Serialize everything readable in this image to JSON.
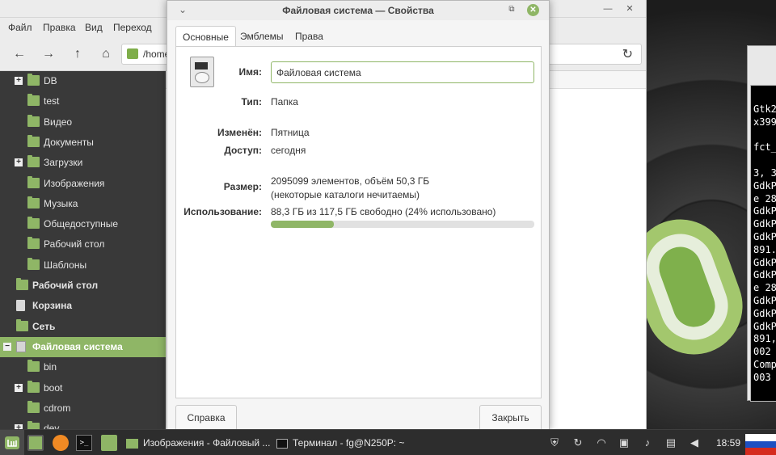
{
  "file_manager": {
    "menu": [
      "Файл",
      "Правка",
      "Вид",
      "Переход"
    ],
    "location": "/home",
    "sidebar": [
      {
        "label": "DB",
        "expander": "+",
        "kind": "folder",
        "bold": false
      },
      {
        "label": "test",
        "expander": "",
        "kind": "folder",
        "bold": false
      },
      {
        "label": "Видео",
        "expander": "",
        "kind": "folder",
        "bold": false
      },
      {
        "label": "Документы",
        "expander": "",
        "kind": "folder",
        "bold": false
      },
      {
        "label": "Загрузки",
        "expander": "+",
        "kind": "folder",
        "bold": false
      },
      {
        "label": "Изображения",
        "expander": "",
        "kind": "folder",
        "bold": false
      },
      {
        "label": "Музыка",
        "expander": "",
        "kind": "folder",
        "bold": false
      },
      {
        "label": "Общедоступные",
        "expander": "",
        "kind": "folder",
        "bold": false
      },
      {
        "label": "Рабочий стол",
        "expander": "",
        "kind": "folder",
        "bold": false
      },
      {
        "label": "Шаблоны",
        "expander": "",
        "kind": "folder",
        "bold": false
      },
      {
        "label": "Рабочий стол",
        "expander": "",
        "kind": "folder",
        "bold": true
      },
      {
        "label": "Корзина",
        "expander": "",
        "kind": "trash",
        "bold": true
      },
      {
        "label": "Сеть",
        "expander": "",
        "kind": "folder",
        "bold": true
      },
      {
        "label": "Файловая система",
        "expander": "−",
        "kind": "drive",
        "bold": true,
        "active": true
      },
      {
        "label": "bin",
        "expander": "",
        "kind": "folder",
        "bold": false
      },
      {
        "label": "boot",
        "expander": "+",
        "kind": "folder",
        "bold": false
      },
      {
        "label": "cdrom",
        "expander": "",
        "kind": "folder",
        "bold": false
      },
      {
        "label": "dev",
        "expander": "+",
        "kind": "folder",
        "bold": false
      }
    ]
  },
  "dialog": {
    "title": "Файловая система — Свойства",
    "menu_glyph": "⌄",
    "restore_glyph": "⧉",
    "close_glyph": "✕",
    "tabs": [
      "Основные",
      "Эмблемы",
      "Права"
    ],
    "active_tab": 0,
    "icon": "drive-harddisk-icon",
    "name_label": "Имя:",
    "name_value": "Файловая система",
    "type_label": "Тип:",
    "type_value": "Папка",
    "modified_label": "Изменён:",
    "modified_value": "Пятница",
    "accessed_label": "Доступ:",
    "accessed_value": "сегодня",
    "size_label": "Размер:",
    "size_value_line1": "2095099 элементов, объём 50,3 ГБ",
    "size_value_line2": "(некоторые каталоги нечитаемы)",
    "usage_label": "Использование:",
    "usage_value": "88,3 ГБ из 117,5 ГБ свободно (24% использовано)",
    "usage_fraction": 0.24,
    "help_button": "Справка",
    "close_button": "Закрыть"
  },
  "terminal": {
    "lines": [
      "Gtk2",
      "x399",
      "",
      "fct_",
      "",
      "3, 3",
      "GdkP",
      "e 28",
      "GdkP",
      "GdkP",
      "GdkP",
      "891.",
      "GdkP",
      "GdkP",
      "e 28",
      "GdkP",
      "GdkP",
      "GdkP",
      "891,",
      "002",
      "Comp",
      "003"
    ]
  },
  "taskbar": {
    "tasks": [
      {
        "label": "Изображения - Файловый ...",
        "icon": "folder-icon"
      },
      {
        "label": "Терминал - fg@N250P: ~",
        "icon": "terminal-icon"
      }
    ],
    "clock": "18:59"
  },
  "colors": {
    "accent": "#8fb666",
    "sidebar_bg": "#393939",
    "taskbar_bg": "#2d2d2d"
  }
}
